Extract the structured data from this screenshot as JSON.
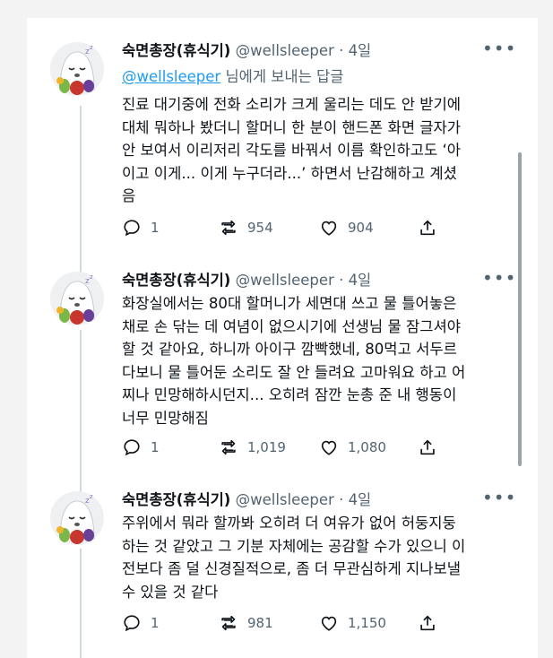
{
  "author": {
    "name": "숙면총장(휴식기)",
    "handle": "@wellsleeper",
    "avatar_icon": "sleepy-ghost-icon"
  },
  "colors": {
    "link": "#1d9bf0",
    "muted": "#536471",
    "text": "#0f1419",
    "thread_line": "#cfd9de"
  },
  "tweets": [
    {
      "time": "4일",
      "reply_to_handle": "@wellsleeper",
      "reply_to_suffix": "님에게 보내는 답글",
      "lines": [
        "진료 대기중에 전화 소리가 크게 울리는 데도 안 받기에",
        "대체 뭐하나 봤더니 할머니 한 분이 핸드폰 화면 글자가",
        "안 보여서 이리저리 각도를 바꿔서 이름 확인하고도 ‘아",
        "이고 이게... 이게 누구더라...’ 하면서 난감해하고 계셨",
        "음"
      ],
      "replies": "1",
      "retweets": "954",
      "likes": "904"
    },
    {
      "time": "4일",
      "lines": [
        "화장실에서는 80대 할머니가 세면대 쓰고 물 틀어놓은",
        "채로 손 닦는 데 여념이 없으시기에 선생님 물 잠그셔야",
        "할 것 같아요, 하니까 아이구 깜빡했네, 80먹고 서두르",
        "다보니 물 틀어둔 소리도 잘 안 들려요 고마워요 하고 어",
        "찌나 민망해하시던지... 오히려 잠깐 눈총 준 내 행동이",
        "너무 민망해짐"
      ],
      "replies": "1",
      "retweets": "1,019",
      "likes": "1,080"
    },
    {
      "time": "4일",
      "lines": [
        "주위에서 뭐라 할까봐 오히려 더 여유가 없어 허둥지둥",
        "하는 것 같았고 그 기분 자체에는 공감할 수가 있으니 이",
        "전보다 좀 덜 신경질적으로, 좀 더 무관심하게 지나보낼",
        "수 있을 것 같다"
      ],
      "replies": "1",
      "retweets": "981",
      "likes": "1,150"
    }
  ]
}
